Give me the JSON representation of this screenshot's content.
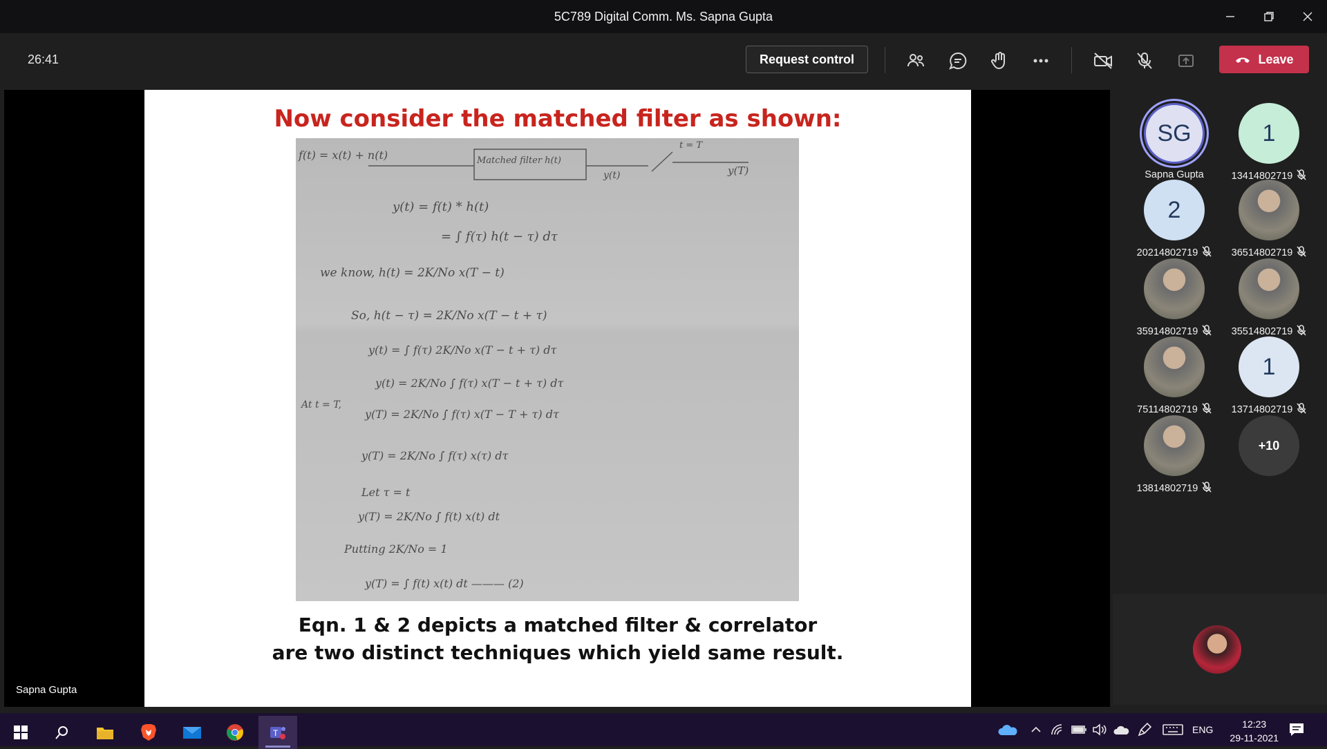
{
  "window": {
    "title": "5C789 Digital Comm. Ms. Sapna Gupta"
  },
  "toolbar": {
    "timer": "26:41",
    "request_control_label": "Request control",
    "leave_label": "Leave"
  },
  "slide": {
    "title": "Now consider the matched filter as shown:",
    "caption_line1": "Eqn. 1 & 2 depicts a matched filter & correlator",
    "caption_line2": "are two distinct techniques which yield  same result.",
    "handwritten": {
      "line1_input": "f(t) = x(t) + n(t)",
      "block_label": "Matched filter h(t)",
      "block_out": "y(t)",
      "switch_label": "t = T",
      "final_out": "y(T)",
      "eq1": "y(t) = f(t) * h(t)",
      "eq2": "= ∫ f(τ) h(t − τ) dτ",
      "eq3": "we know,   h(t) = 2K/No x(T − t)",
      "eq4": "So,   h(t − τ) = 2K/No x(T − t + τ)",
      "eq5": "y(t) = ∫ f(τ) 2K/No x(T − t + τ) dτ",
      "eq6": "y(t) = 2K/No ∫ f(τ) x(T − t + τ) dτ",
      "eq7_prefix": "At t = T,",
      "eq7": "y(T) = 2K/No ∫ f(τ) x(T − T + τ) dτ",
      "eq8": "y(T) = 2K/No ∫ f(τ) x(τ) dτ",
      "eq9": "Let  τ = t",
      "eq10": "y(T) = 2K/No ∫ f(t) x(t) dt",
      "eq11": "Putting  2K/No = 1",
      "eq12": "y(T) = ∫ f(t) x(t) dt ——— (2)"
    }
  },
  "stage": {
    "speaker_label": "Sapna Gupta"
  },
  "participants": [
    {
      "initials": "SG",
      "name": "Sapna Gupta",
      "muted": false,
      "color": "#dfe1f3",
      "kind": "initials",
      "ring": true
    },
    {
      "initials": "1",
      "name": "13414802719",
      "muted": true,
      "color": "#c6edd8",
      "kind": "initials"
    },
    {
      "initials": "2",
      "name": "20214802719",
      "muted": true,
      "color": "#cfe0f3",
      "kind": "initials"
    },
    {
      "initials": "",
      "name": "36514802719",
      "muted": true,
      "kind": "photo"
    },
    {
      "initials": "",
      "name": "35914802719",
      "muted": true,
      "kind": "photo"
    },
    {
      "initials": "",
      "name": "35514802719",
      "muted": true,
      "kind": "photo"
    },
    {
      "initials": "",
      "name": "75114802719",
      "muted": true,
      "kind": "photo"
    },
    {
      "initials": "1",
      "name": "13714802719",
      "muted": true,
      "color": "#dce6f2",
      "kind": "initials"
    },
    {
      "initials": "",
      "name": "13814802719",
      "muted": true,
      "kind": "photo"
    },
    {
      "initials": "+10",
      "name": "",
      "muted": false,
      "color": "#3b3b3b",
      "kind": "more"
    }
  ],
  "taskbar": {
    "language": "ENG",
    "time": "12:23",
    "date": "29-11-2021"
  }
}
